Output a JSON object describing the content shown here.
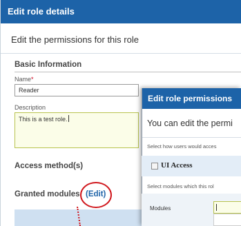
{
  "edit_role": {
    "title": "Edit role details",
    "subtitle": "Edit the permissions for this role",
    "basic_info": {
      "heading": "Basic Information",
      "name_label": "Name",
      "name_required": "*",
      "name_value": "Reader",
      "description_label": "Description",
      "description_value": "This is a test role."
    },
    "access_method_heading": "Access method(s)",
    "granted_modules_heading": "Granted modules",
    "edit_link": "(Edit)"
  },
  "edit_permissions": {
    "title": "Edit role permissions",
    "subtitle": "You can edit the permi",
    "how_access_text": "Select how users would acces",
    "ui_access_label": "UI Access",
    "select_modules_text": "Select modules which this rol",
    "modules_label": "Modules",
    "modules_value": ""
  },
  "colors": {
    "title_bar": "#1d63a8",
    "highlight_circle": "#d0161c",
    "active_field": "#fbfde8"
  },
  "icons": [
    "checkbox-icon",
    "annotation-circle",
    "annotation-dotted-arrow"
  ]
}
